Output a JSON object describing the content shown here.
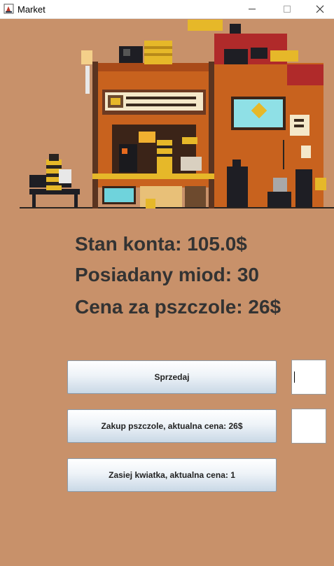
{
  "window": {
    "title": "Market"
  },
  "stats": {
    "balance": "Stan konta: 105.0$",
    "honey": "Posiadany miod: 30",
    "bee_price": "Cena za pszczole: 26$"
  },
  "buttons": {
    "sell": "Sprzedaj",
    "buy_bee": "Zakup pszczole, aktualna cena: 26$",
    "plant_flower": "Zasiej kwiatka, aktualna cena: 1"
  },
  "inputs": {
    "sell_amount": "",
    "buy_amount": ""
  },
  "icons": {
    "app": "java-app-icon",
    "minimize": "minimize-icon",
    "maximize": "maximize-icon",
    "close": "close-icon"
  }
}
